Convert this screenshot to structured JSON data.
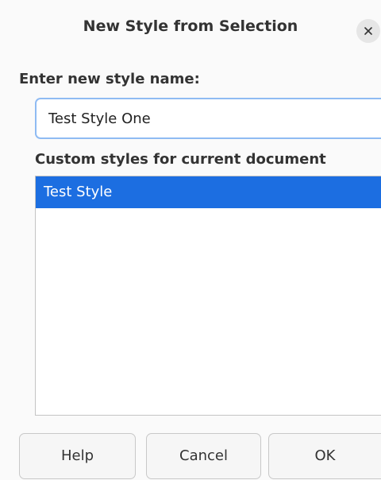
{
  "dialog": {
    "title": "New Style from Selection",
    "close_icon": "close-icon"
  },
  "name_field": {
    "label": "Enter new style name:",
    "value": "Test Style One"
  },
  "custom_styles": {
    "label": "Custom styles for current document",
    "items": [
      {
        "label": "Test Style",
        "selected": true
      }
    ]
  },
  "buttons": {
    "help": "Help",
    "cancel": "Cancel",
    "ok": "OK"
  },
  "colors": {
    "selection": "#1c6ee1",
    "focus_border": "#8fbbf3"
  }
}
